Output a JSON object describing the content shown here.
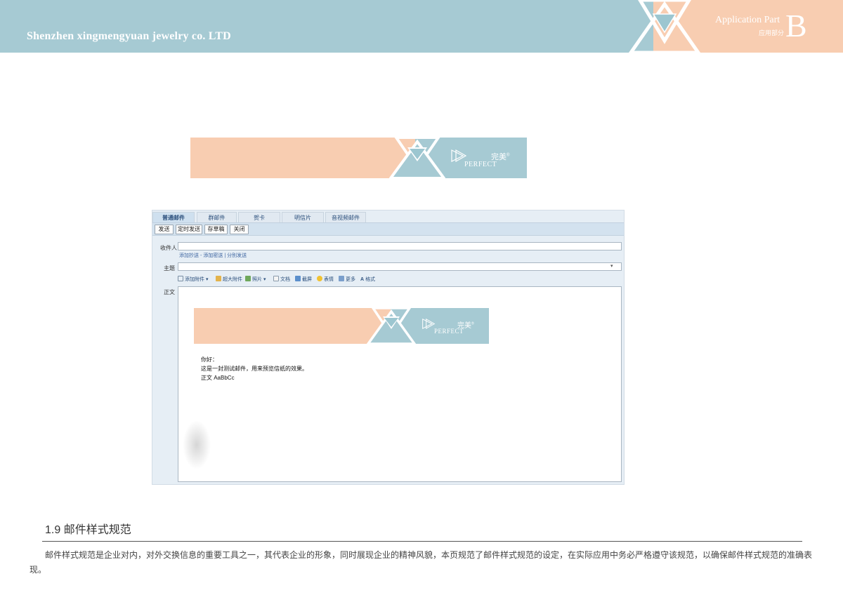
{
  "header": {
    "company": "Shenzhen xingmengyuan jewelry co. LTD",
    "application_part": "Application Part",
    "application_part_cn": "应用部分",
    "part_letter": "B"
  },
  "colors": {
    "blue": "#a6cad3",
    "peach": "#f8cdb1",
    "white": "#ffffff"
  },
  "banner": {
    "brand_cn": "完美",
    "brand_en": "PERFECT",
    "registered": "®"
  },
  "email_client": {
    "tabs": [
      "普通邮件",
      "群邮件",
      "贺卡",
      "明信片",
      "音视频邮件"
    ],
    "toolbar": [
      "发送",
      "定时发送",
      "存草稿",
      "关闭"
    ],
    "recipient_label": "收件人",
    "recipient_links": [
      "添加抄送",
      "-",
      "添加密送",
      "|",
      "分别发送"
    ],
    "subject_label": "主题",
    "subject_value": "",
    "format_tools": [
      "添加附件",
      "超大附件",
      "照片",
      "文档",
      "截屏",
      "表情",
      "更多",
      "格式"
    ],
    "body_label": "正文",
    "message": {
      "greeting": "你好：",
      "line1": "这是一封测试邮件，用来预览信纸的效果。",
      "line2": "正文 AaBbCc"
    }
  },
  "section": {
    "title": "1.9 邮件样式规范",
    "description": "邮件样式规范是企业对内，对外交换信息的重要工具之一，其代表企业的形象，同时展现企业的精神风貌，本页规范了邮件样式规范的设定，在实际应用中务必严格遵守该规范，以确保邮件样式规范的准确表现。"
  }
}
